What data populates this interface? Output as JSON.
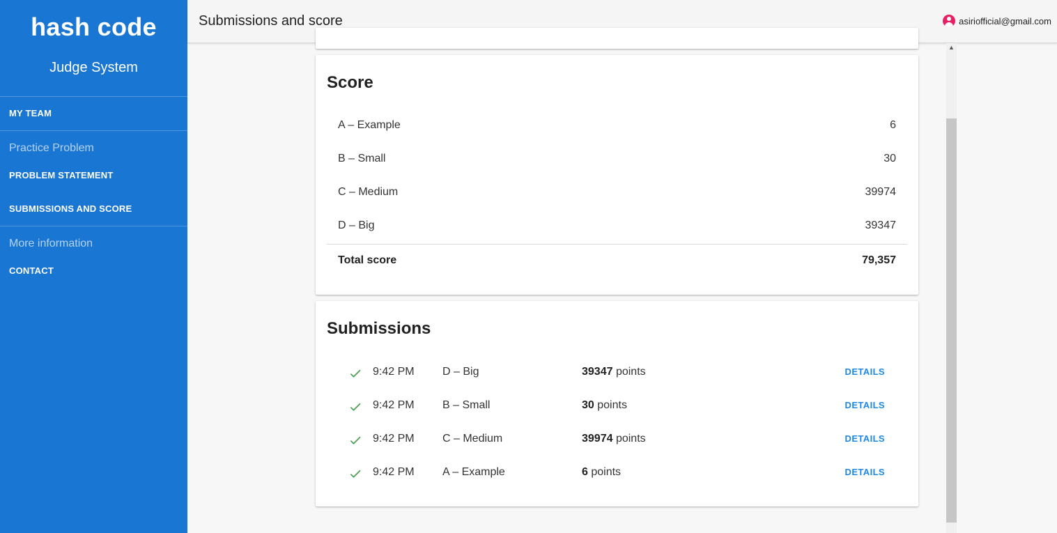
{
  "sidebar": {
    "logo": "hash code",
    "subtitle": "Judge System",
    "my_team": "MY TEAM",
    "practice_header": "Practice Problem",
    "problem_statement": "PROBLEM STATEMENT",
    "submissions_and_score": "SUBMISSIONS AND SCORE",
    "more_info_header": "More information",
    "contact": "CONTACT"
  },
  "header": {
    "title": "Submissions and score",
    "account_email": "asiriofficial@gmail.com"
  },
  "score": {
    "title": "Score",
    "rows": [
      {
        "label": "A – Example",
        "value": "6"
      },
      {
        "label": "B – Small",
        "value": "30"
      },
      {
        "label": "C – Medium",
        "value": "39974"
      },
      {
        "label": "D – Big",
        "value": "39347"
      }
    ],
    "total_label": "Total score",
    "total_value": "79,357"
  },
  "submissions": {
    "title": "Submissions",
    "rows": [
      {
        "time": "9:42 PM",
        "problem": "D – Big",
        "points": "39347",
        "points_unit": "points",
        "action": "DETAILS"
      },
      {
        "time": "9:42 PM",
        "problem": "B – Small",
        "points": "30",
        "points_unit": "points",
        "action": "DETAILS"
      },
      {
        "time": "9:42 PM",
        "problem": "C – Medium",
        "points": "39974",
        "points_unit": "points",
        "action": "DETAILS"
      },
      {
        "time": "9:42 PM",
        "problem": "A – Example",
        "points": "6",
        "points_unit": "points",
        "action": "DETAILS"
      }
    ]
  },
  "colors": {
    "sidebar": "#1976d2",
    "check": "#43a047",
    "details_link": "#1e88e5",
    "avatar": "#e91e63"
  }
}
